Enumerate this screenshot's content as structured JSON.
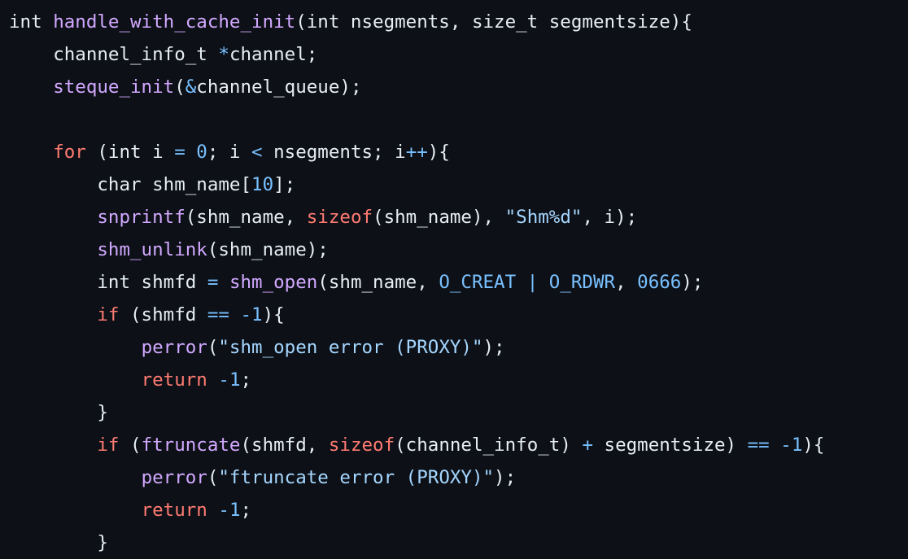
{
  "theme": {
    "background": "#0d1117",
    "text": "#e6edf3",
    "keyword": "#ff7b72",
    "function": "#d2a8ff",
    "number": "#79c0ff",
    "operator": "#79c0ff",
    "string": "#a5d6ff"
  },
  "code": {
    "lines": [
      {
        "indent": "",
        "tokens": [
          [
            "t",
            "int "
          ],
          [
            "f",
            "handle_with_cache_init"
          ],
          [
            "t",
            "(int nsegments, size_t segmentsize){"
          ]
        ]
      },
      {
        "indent": "    ",
        "tokens": [
          [
            "t",
            "channel_info_t "
          ],
          [
            "o",
            "*"
          ],
          [
            "t",
            "channel;"
          ]
        ]
      },
      {
        "indent": "    ",
        "tokens": [
          [
            "f",
            "steque_init"
          ],
          [
            "t",
            "("
          ],
          [
            "o",
            "&"
          ],
          [
            "t",
            "channel_queue);"
          ]
        ]
      },
      {
        "indent": "",
        "tokens": []
      },
      {
        "indent": "    ",
        "tokens": [
          [
            "k",
            "for"
          ],
          [
            "t",
            " (int i "
          ],
          [
            "o",
            "="
          ],
          [
            "t",
            " "
          ],
          [
            "n",
            "0"
          ],
          [
            "t",
            "; i "
          ],
          [
            "o",
            "<"
          ],
          [
            "t",
            " nsegments; i"
          ],
          [
            "o",
            "++"
          ],
          [
            "t",
            "){"
          ]
        ]
      },
      {
        "indent": "        ",
        "tokens": [
          [
            "t",
            "char shm_name["
          ],
          [
            "n",
            "10"
          ],
          [
            "t",
            "];"
          ]
        ]
      },
      {
        "indent": "        ",
        "tokens": [
          [
            "f",
            "snprintf"
          ],
          [
            "t",
            "(shm_name, "
          ],
          [
            "k",
            "sizeof"
          ],
          [
            "t",
            "(shm_name), "
          ],
          [
            "s",
            "\"Shm%d\""
          ],
          [
            "t",
            ", i);"
          ]
        ]
      },
      {
        "indent": "        ",
        "tokens": [
          [
            "f",
            "shm_unlink"
          ],
          [
            "t",
            "(shm_name);"
          ]
        ]
      },
      {
        "indent": "        ",
        "tokens": [
          [
            "t",
            "int shmfd "
          ],
          [
            "o",
            "="
          ],
          [
            "t",
            " "
          ],
          [
            "f",
            "shm_open"
          ],
          [
            "t",
            "(shm_name, "
          ],
          [
            "n",
            "O_CREAT"
          ],
          [
            "t",
            " "
          ],
          [
            "o",
            "|"
          ],
          [
            "t",
            " "
          ],
          [
            "n",
            "O_RDWR"
          ],
          [
            "t",
            ", "
          ],
          [
            "n",
            "0666"
          ],
          [
            "t",
            ");"
          ]
        ]
      },
      {
        "indent": "        ",
        "tokens": [
          [
            "k",
            "if"
          ],
          [
            "t",
            " (shmfd "
          ],
          [
            "o",
            "=="
          ],
          [
            "t",
            " "
          ],
          [
            "o",
            "-"
          ],
          [
            "n",
            "1"
          ],
          [
            "t",
            "){"
          ]
        ]
      },
      {
        "indent": "            ",
        "tokens": [
          [
            "f",
            "perror"
          ],
          [
            "t",
            "("
          ],
          [
            "s",
            "\"shm_open error (PROXY)\""
          ],
          [
            "t",
            ");"
          ]
        ]
      },
      {
        "indent": "            ",
        "tokens": [
          [
            "k",
            "return"
          ],
          [
            "t",
            " "
          ],
          [
            "o",
            "-"
          ],
          [
            "n",
            "1"
          ],
          [
            "t",
            ";"
          ]
        ]
      },
      {
        "indent": "        ",
        "tokens": [
          [
            "t",
            "}"
          ]
        ]
      },
      {
        "indent": "        ",
        "tokens": [
          [
            "k",
            "if"
          ],
          [
            "t",
            " ("
          ],
          [
            "f",
            "ftruncate"
          ],
          [
            "t",
            "(shmfd, "
          ],
          [
            "k",
            "sizeof"
          ],
          [
            "t",
            "(channel_info_t) "
          ],
          [
            "o",
            "+"
          ],
          [
            "t",
            " segmentsize) "
          ],
          [
            "o",
            "=="
          ],
          [
            "t",
            " "
          ],
          [
            "o",
            "-"
          ],
          [
            "n",
            "1"
          ],
          [
            "t",
            "){"
          ]
        ]
      },
      {
        "indent": "            ",
        "tokens": [
          [
            "f",
            "perror"
          ],
          [
            "t",
            "("
          ],
          [
            "s",
            "\"ftruncate error (PROXY)\""
          ],
          [
            "t",
            ");"
          ]
        ]
      },
      {
        "indent": "            ",
        "tokens": [
          [
            "k",
            "return"
          ],
          [
            "t",
            " "
          ],
          [
            "o",
            "-"
          ],
          [
            "n",
            "1"
          ],
          [
            "t",
            ";"
          ]
        ]
      },
      {
        "indent": "        ",
        "tokens": [
          [
            "t",
            "}"
          ]
        ]
      }
    ]
  }
}
